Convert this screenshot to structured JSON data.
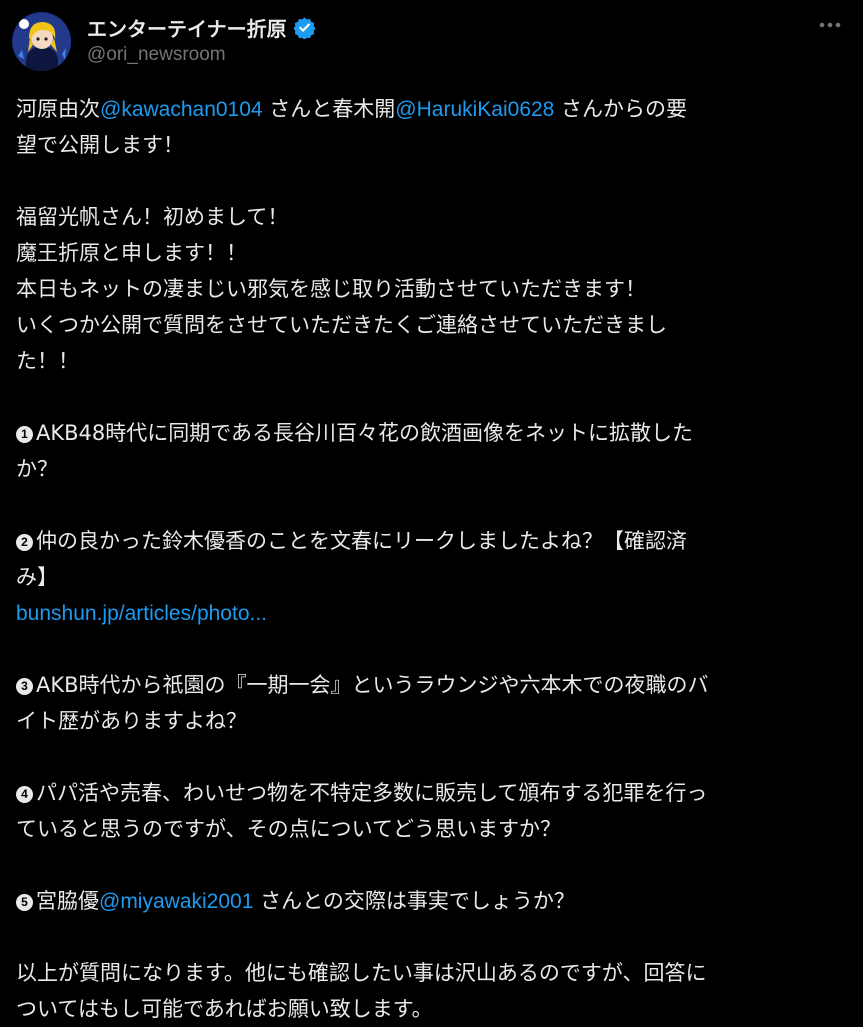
{
  "author": {
    "display_name": "エンターテイナー折原",
    "handle": "@ori_newsroom",
    "verified_color": "#1d9bf0"
  },
  "more_icon": "more-dots-icon",
  "tweet": {
    "l1a": "河原由次",
    "l1_mention1": "@kawachan0104",
    "l1b": " さんと春木開",
    "l1_mention2": "@HarukiKai0628",
    "l1c": " さんからの要",
    "l2": "望で公開します！",
    "l3": "福留光帆さん！初めまして！",
    "l4": "魔王折原と申します！！",
    "l5": "本日もネットの凄まじい邪気を感じ取り活動させていただきます！",
    "l6": "いくつか公開で質問をさせていただきたくご連絡させていただきまし",
    "l7": "た！！",
    "q1_num": "1",
    "q1_line1": "AKB48時代に同期である長谷川百々花の飲酒画像をネットに拡散した",
    "q1_line2": "か？",
    "q2_num": "2",
    "q2_line1": "仲の良かった鈴木優香のことを文春にリークしましたよね？【確認済",
    "q2_line2": "み】",
    "q2_link": "bunshun.jp/articles/photo...",
    "q3_num": "3",
    "q3_line1": "AKB時代から祇園の『一期一会』というラウンジや六本木での夜職のバ",
    "q3_line2": "イト歴がありますよね？",
    "q4_num": "4",
    "q4_line1": "パパ活や売春、わいせつ物を不特定多数に販売して頒布する犯罪を行っ",
    "q4_line2": "ていると思うのですが、その点についてどう思いますか？",
    "q5_num": "5",
    "q5_a": "宮脇優",
    "q5_mention": "@miyawaki2001",
    "q5_b": " さんとの交際は事実でしょうか？",
    "end1": "以上が質問になります。他にも確認したい事は沢山あるのですが、回答に",
    "end2": "ついてはもし可能であればお願い致します。"
  },
  "colors": {
    "background": "#000000",
    "text": "#e7e9ea",
    "secondary": "#71767b",
    "link": "#1d9bf0"
  }
}
